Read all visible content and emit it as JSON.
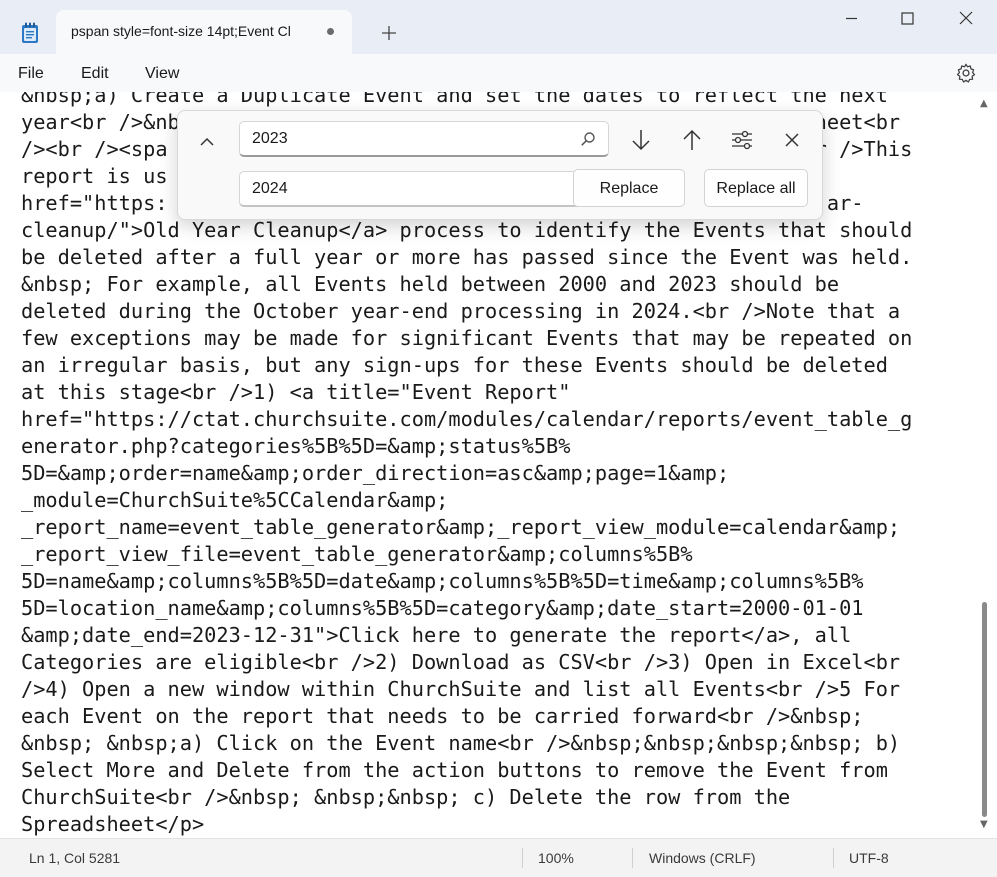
{
  "tab": {
    "title": "pspan style=font-size 14pt;Event Cl"
  },
  "menu": {
    "file": "File",
    "edit": "Edit",
    "view": "View"
  },
  "editor": {
    "lines": [
      "&nbsp;a) Create a Duplicate Event and set the dates to reflect the next",
      "year<br />&nb                                                 adsheet<br",
      "/><br /><spa                                                 n><br />This",
      "report is us",
      "href=\"https:                                                      ar-",
      "cleanup/\">Old Year Cleanup</a> process to identify the Events that should",
      "be deleted after a full year or more has passed since the Event was held.",
      "&nbsp; For example, all Events held between 2000 and 2023 should be",
      "deleted during the October year-end processing in 2024.<br />Note that a",
      "few exceptions may be made for significant Events that may be repeated on",
      "an irregular basis, but any sign-ups for these Events should be deleted",
      "at this stage<br />1) <a title=\"Event Report\"",
      "href=\"https://ctat.churchsuite.com/modules/calendar/reports/event_table_g",
      "enerator.php?categories%5B%5D=&amp;status%5B%",
      "5D=&amp;order=name&amp;order_direction=asc&amp;page=1&amp;",
      "_module=ChurchSuite%5CCalendar&amp;",
      "_report_name=event_table_generator&amp;_report_view_module=calendar&amp;",
      "_report_view_file=event_table_generator&amp;columns%5B%",
      "5D=name&amp;columns%5B%5D=date&amp;columns%5B%5D=time&amp;columns%5B%",
      "5D=location_name&amp;columns%5B%5D=category&amp;date_start=2000-01-01",
      "&amp;date_end=2023-12-31\">Click here to generate the report</a>, all",
      "Categories are eligible<br />2) Download as CSV<br />3) Open in Excel<br",
      "/>4) Open a new window within ChurchSuite and list all Events<br />5 For",
      "each Event on the report that needs to be carried forward<br />&nbsp;",
      "&nbsp; &nbsp;a) Click on the Event name<br />&nbsp;&nbsp;&nbsp;&nbsp; b)",
      "Select More and Delete from the action buttons to remove the Event from",
      "ChurchSuite<br />&nbsp; &nbsp;&nbsp; c) Delete the row from the",
      "Spreadsheet</p>"
    ]
  },
  "find": {
    "search_value": "2023",
    "replace_value": "2024",
    "replace_label": "Replace",
    "replace_all_label": "Replace all"
  },
  "status": {
    "position": "Ln 1, Col 5281",
    "zoom": "100%",
    "line_ending": "Windows (CRLF)",
    "encoding": "UTF-8"
  }
}
